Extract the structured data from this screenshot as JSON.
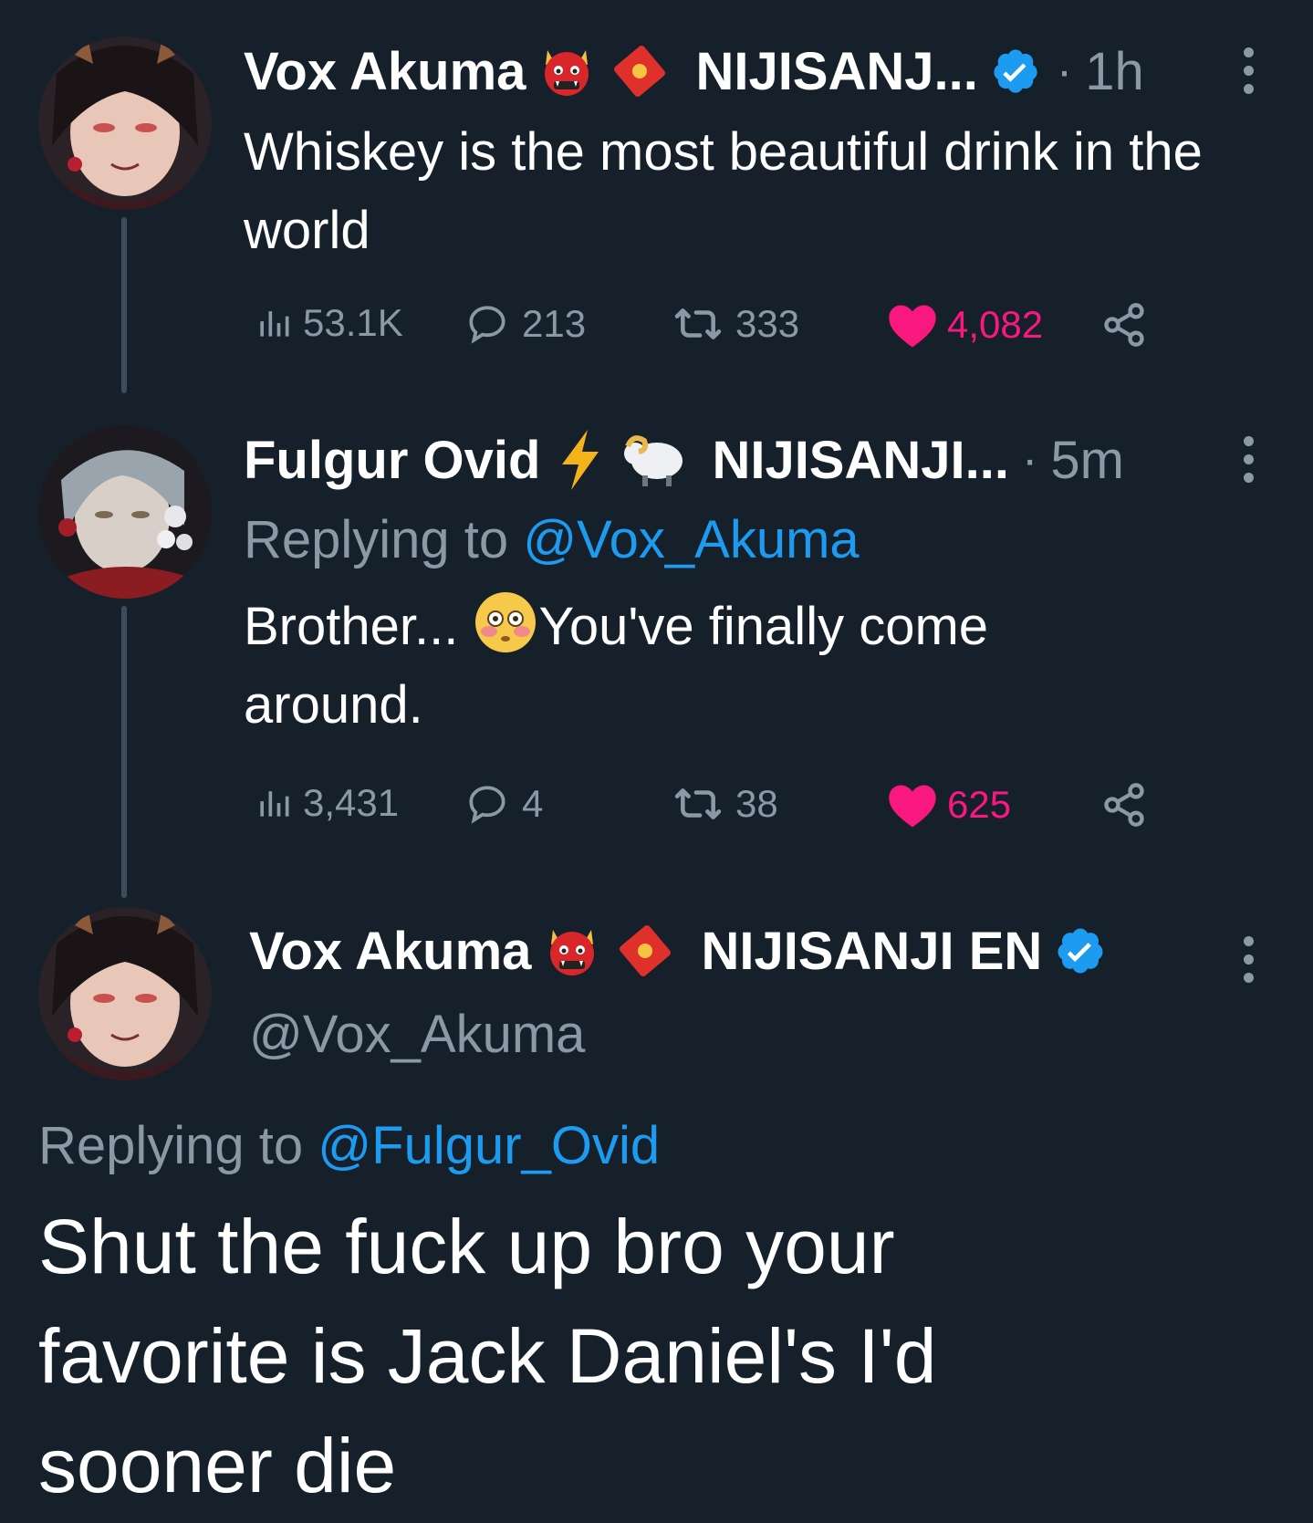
{
  "tweets": [
    {
      "name": "Vox Akuma",
      "affiliation": "NIJISANJ...",
      "time": "1h",
      "text": "Whiskey is the most beautiful drink in the world",
      "stats": {
        "views": "53.1K",
        "replies": "213",
        "retweets": "333",
        "likes": "4,082"
      },
      "icons": [
        "ogre-emoji",
        "red-envelope-emoji",
        "verified-badge-icon"
      ]
    },
    {
      "name": "Fulgur Ovid",
      "affiliation": "NIJISANJI...",
      "time": "5m",
      "replying_prefix": "Replying to",
      "replying_to": "@Vox_Akuma",
      "text_before": "Brother...",
      "text_after": "You've finally come around.",
      "stats": {
        "views": "3,431",
        "replies": "4",
        "retweets": "38",
        "likes": "625"
      },
      "icons": [
        "lightning-emoji",
        "ram-emoji",
        "flushed-face-emoji"
      ]
    },
    {
      "name": "Vox Akuma",
      "affiliation": "NIJISANJI EN",
      "handle": "@Vox_Akuma",
      "replying_prefix": "Replying to",
      "replying_to": "@Fulgur_Ovid",
      "text": "Shut the fuck up bro your favorite is Jack Daniel's I'd sooner die",
      "icons": [
        "ogre-emoji",
        "red-envelope-emoji",
        "verified-badge-icon"
      ]
    }
  ],
  "separator": "·",
  "colors": {
    "background": "#15202b",
    "muted": "#8b98a5",
    "link": "#1d9bf0",
    "like": "#f91880",
    "thread_line": "#3d4c5b"
  }
}
